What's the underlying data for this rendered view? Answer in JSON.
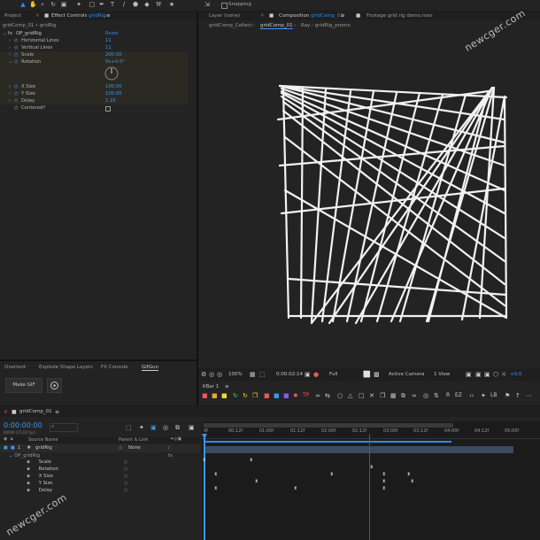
{
  "toolbar": {
    "snapping_label": "Snapping"
  },
  "left_panel": {
    "tab_project": "Project",
    "tab_effect_controls": "Effect Controls",
    "tab_effect_controls_target": "gridRig",
    "breadcrumb": "gridComp_01 • gridRig",
    "effect_name": "OP_gridRig",
    "reset_label": "Reset",
    "properties": [
      {
        "label": "Horizontal Lines",
        "value": "11"
      },
      {
        "label": "Vertical Lines",
        "value": "11"
      },
      {
        "label": "Scale",
        "value": "200.00"
      },
      {
        "label": "Rotation",
        "value": "0x+0.0°"
      },
      {
        "label": "X Size",
        "value": "100.00"
      },
      {
        "label": "Y Size",
        "value": "100.00"
      },
      {
        "label": "Delay",
        "value": "1.25"
      },
      {
        "label": "Centered?",
        "value": ""
      }
    ]
  },
  "bottom_left_panel": {
    "tabs": [
      "Overlord",
      "Explode Shape Layers",
      "FX Console",
      "GifGun"
    ],
    "make_gif_label": "Make GIF"
  },
  "viewer": {
    "tab_layer": "Layer (none)",
    "tab_composition": "Composition",
    "tab_composition_name": "gridComp_01",
    "tab_footage": "Footage grid rig demo.mov",
    "subtabs": [
      "gridComp_Collect",
      "gridComp_01",
      "Ray - gridRig_promo"
    ],
    "zoom": "100%",
    "timecode": "0:00:02:14",
    "resolution": "Full",
    "camera": "Active Camera",
    "view": "1 View",
    "exposure": "+0.0"
  },
  "kbar": {
    "label": "KBar 1",
    "buttons": [
      "TP",
      "R",
      "EZ",
      "LB"
    ]
  },
  "timeline": {
    "comp_tab": "gridComp_01",
    "timecode": "0:00:00:00",
    "timecode_sub": "00000 (25.00 fps)",
    "col_source_name": "Source Name",
    "col_parent": "Parent & Link",
    "layer_index": "1",
    "layer_name": "gridRig",
    "parent_value": "None",
    "effect_label": "OP_gridRig",
    "props": [
      "Scale",
      "Rotation",
      "X Size",
      "Y Size",
      "Delay"
    ],
    "ruler": [
      "0f",
      "00:12f",
      "01:00f",
      "01:12f",
      "02:00f",
      "02:12f",
      "03:00f",
      "03:12f",
      "04:00f",
      "04:12f",
      "05:00f"
    ]
  },
  "watermark": "newcger.com"
}
